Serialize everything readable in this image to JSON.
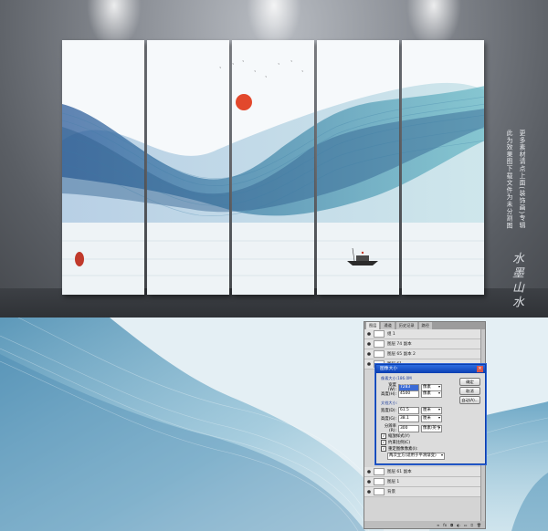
{
  "side_text": {
    "line1": "更多素材请点上面(装饰画)专辑",
    "line2": "此为效果图下载文件为未分割图"
  },
  "calligraphy": "水墨山水",
  "panel_count": 5,
  "colors": {
    "wall": "#8c9097",
    "panel_bg": "#f4f7f9",
    "ink_blue": "#3a6f9f",
    "ink_teal": "#4aa3b3",
    "sun": "#e2482c",
    "seal": "#c0392b",
    "dialog_title": "#0b3fb2"
  },
  "photoshop": {
    "tabs": [
      "图层",
      "通道",
      "历史记录",
      "路径"
    ],
    "layers": [
      {
        "name": "组 1"
      },
      {
        "name": "图层 74 副本"
      },
      {
        "name": "图层 65 副本 2"
      },
      {
        "name": "图层 61"
      }
    ],
    "bottom_layers": [
      {
        "name": "图层 61 副本"
      },
      {
        "name": "图层 1"
      },
      {
        "name": "背景"
      }
    ],
    "dialog": {
      "title": "图像大小",
      "pixel_dimensions_label": "像素大小:186.0M",
      "width_label": "宽度(W):",
      "width_value": "7283",
      "width_unit": "像素",
      "height_label": "高度(H):",
      "height_value": "4500",
      "height_unit": "像素",
      "doc_size_label": "文档大小:",
      "doc_width_label": "宽度(D):",
      "doc_width_value": "61.5",
      "doc_width_unit": "厘米",
      "doc_height_label": "高度(G):",
      "doc_height_value": "38.1",
      "doc_height_unit": "厘米",
      "resolution_label": "分辨率(R):",
      "resolution_value": "300",
      "resolution_unit": "像素/英寸",
      "scale_styles": "缩放样式(Y)",
      "constrain": "约束比例(C)",
      "resample": "重定图像像素(I):",
      "resample_method": "两次立方(适用于平滑渐变)",
      "buttons": [
        "确定",
        "取消",
        "自动(A)..."
      ]
    }
  }
}
